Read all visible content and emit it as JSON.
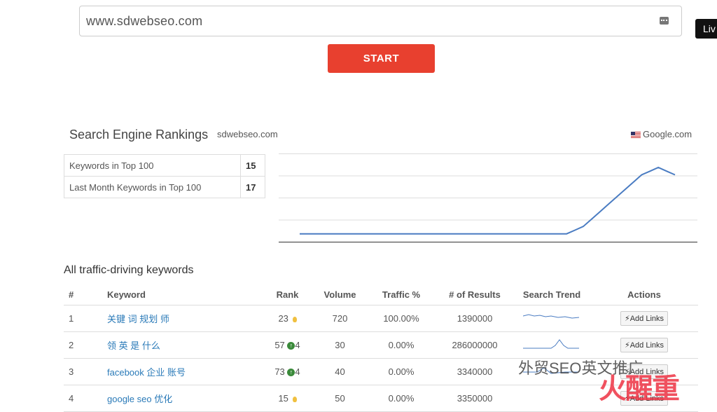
{
  "url_input": {
    "value": "www.sdwebseo.com"
  },
  "live_button": {
    "label": "Liv"
  },
  "start_button": {
    "label": "START"
  },
  "rankings": {
    "title": "Search Engine Rankings",
    "domain": "sdwebseo.com",
    "engine": "Google.com",
    "stats": [
      {
        "label": "Keywords in Top 100",
        "value": "15"
      },
      {
        "label": "Last Month Keywords in Top 100",
        "value": "17"
      }
    ]
  },
  "chart_data": {
    "type": "line",
    "series": [
      {
        "values": [
          1,
          1,
          1,
          1,
          1,
          1,
          1,
          1,
          1,
          1,
          1,
          1,
          1,
          1,
          1,
          1,
          1,
          1,
          1,
          1,
          1,
          1,
          1,
          1,
          1,
          1,
          1,
          1,
          1,
          1,
          1,
          1,
          1,
          2,
          3,
          5,
          7,
          9,
          11,
          13,
          15,
          17,
          18,
          19,
          18,
          17
        ]
      }
    ],
    "grid": true,
    "color": "#4a7cc2"
  },
  "keywords": {
    "title": "All traffic-driving keywords",
    "columns": [
      "#",
      "Keyword",
      "Rank",
      "Volume",
      "Traffic %",
      "# of Results",
      "Search Trend",
      "Actions"
    ],
    "rows": [
      {
        "num": "1",
        "keyword": "关键 词 规划 师",
        "rank": "23",
        "change": "",
        "volume": "720",
        "traffic": "100.00%",
        "results": "1390000",
        "action": "Add Links"
      },
      {
        "num": "2",
        "keyword": "领 英 是 什么",
        "rank": "57",
        "change": "4",
        "volume": "30",
        "traffic": "0.00%",
        "results": "286000000",
        "action": "Add Links"
      },
      {
        "num": "3",
        "keyword": "facebook 企业 账号",
        "rank": "73",
        "change": "4",
        "volume": "40",
        "traffic": "0.00%",
        "results": "3340000",
        "action": "Add Links"
      },
      {
        "num": "4",
        "keyword": "google seo 优化",
        "rank": "15",
        "change": "",
        "volume": "50",
        "traffic": "0.00%",
        "results": "3350000",
        "action": "Add Links"
      }
    ]
  },
  "watermark": {
    "text": "外贸SEO英文推广",
    "logo": "火醒重"
  }
}
